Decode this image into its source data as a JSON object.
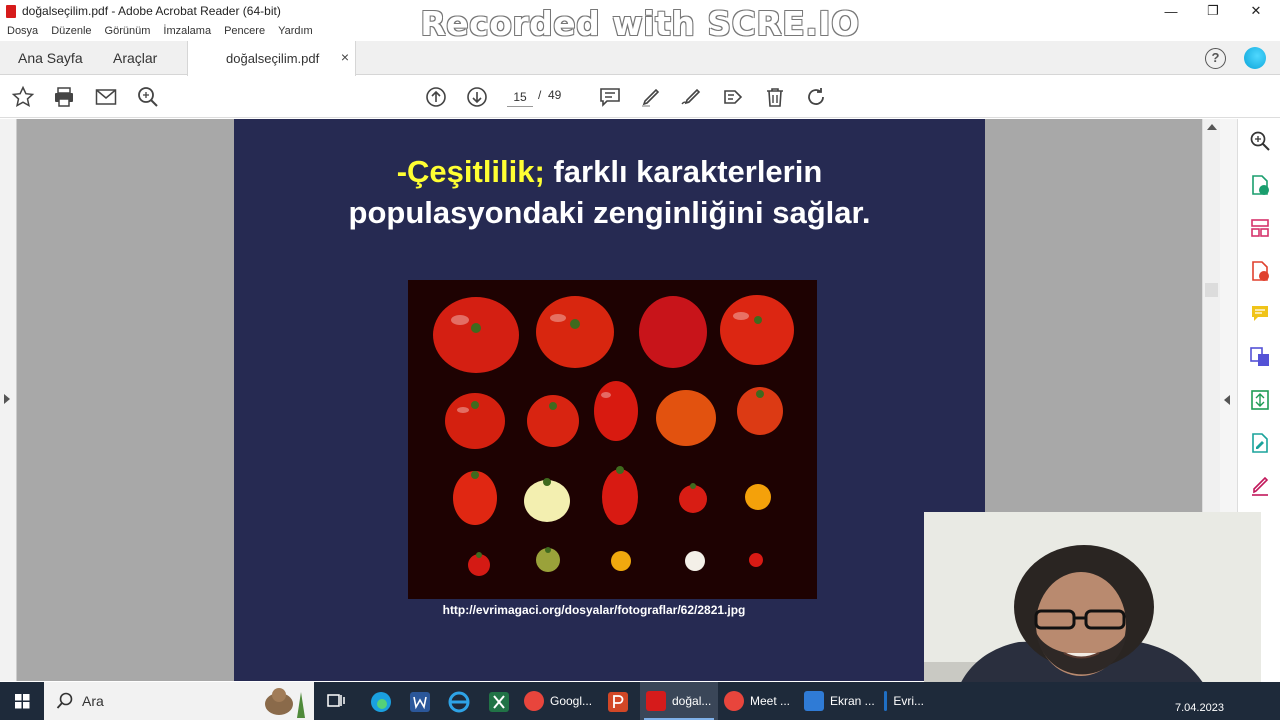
{
  "window": {
    "title": "doğalseçilim.pdf - Adobe Acrobat Reader (64-bit)",
    "watermark": "Recorded with SCRE.IO",
    "minimize": "—",
    "restore": "❐",
    "close": "✕"
  },
  "menu": [
    "Dosya",
    "Düzenle",
    "Görünüm",
    "İmzalama",
    "Pencere",
    "Yardım"
  ],
  "tabs": {
    "home": "Ana Sayfa",
    "tools": "Araçlar",
    "document": "doğalseçilim.pdf",
    "close": "×",
    "help": "?"
  },
  "page_nav": {
    "current": "15",
    "separator": "/",
    "total": "49"
  },
  "slide": {
    "title_highlight": "-Çeşitlilik;",
    "title_rest_line1": " farklı karakterlerin",
    "title_line2": "populasyondaki zenginliğini sağlar.",
    "caption": "http://evrimagaci.org/dosyalar/fotograflar/62/2821.jpg"
  },
  "taskbar": {
    "search": "Ara",
    "apps": [
      {
        "label": "Googl...",
        "color": "#e8453c"
      },
      {
        "label": "doğal...",
        "color": "#d61b1b"
      },
      {
        "label": "Meet ...",
        "color": "#e8453c"
      },
      {
        "label": "Ekran ...",
        "color": "#2f7bd6"
      },
      {
        "label": "Evri...",
        "color": "#1f6fc4"
      }
    ],
    "date": "7.04.2023"
  },
  "colors": {
    "slide_bg": "#262a52",
    "title_highlight": "#ffff33",
    "acrobat_red": "#d61b1b"
  }
}
